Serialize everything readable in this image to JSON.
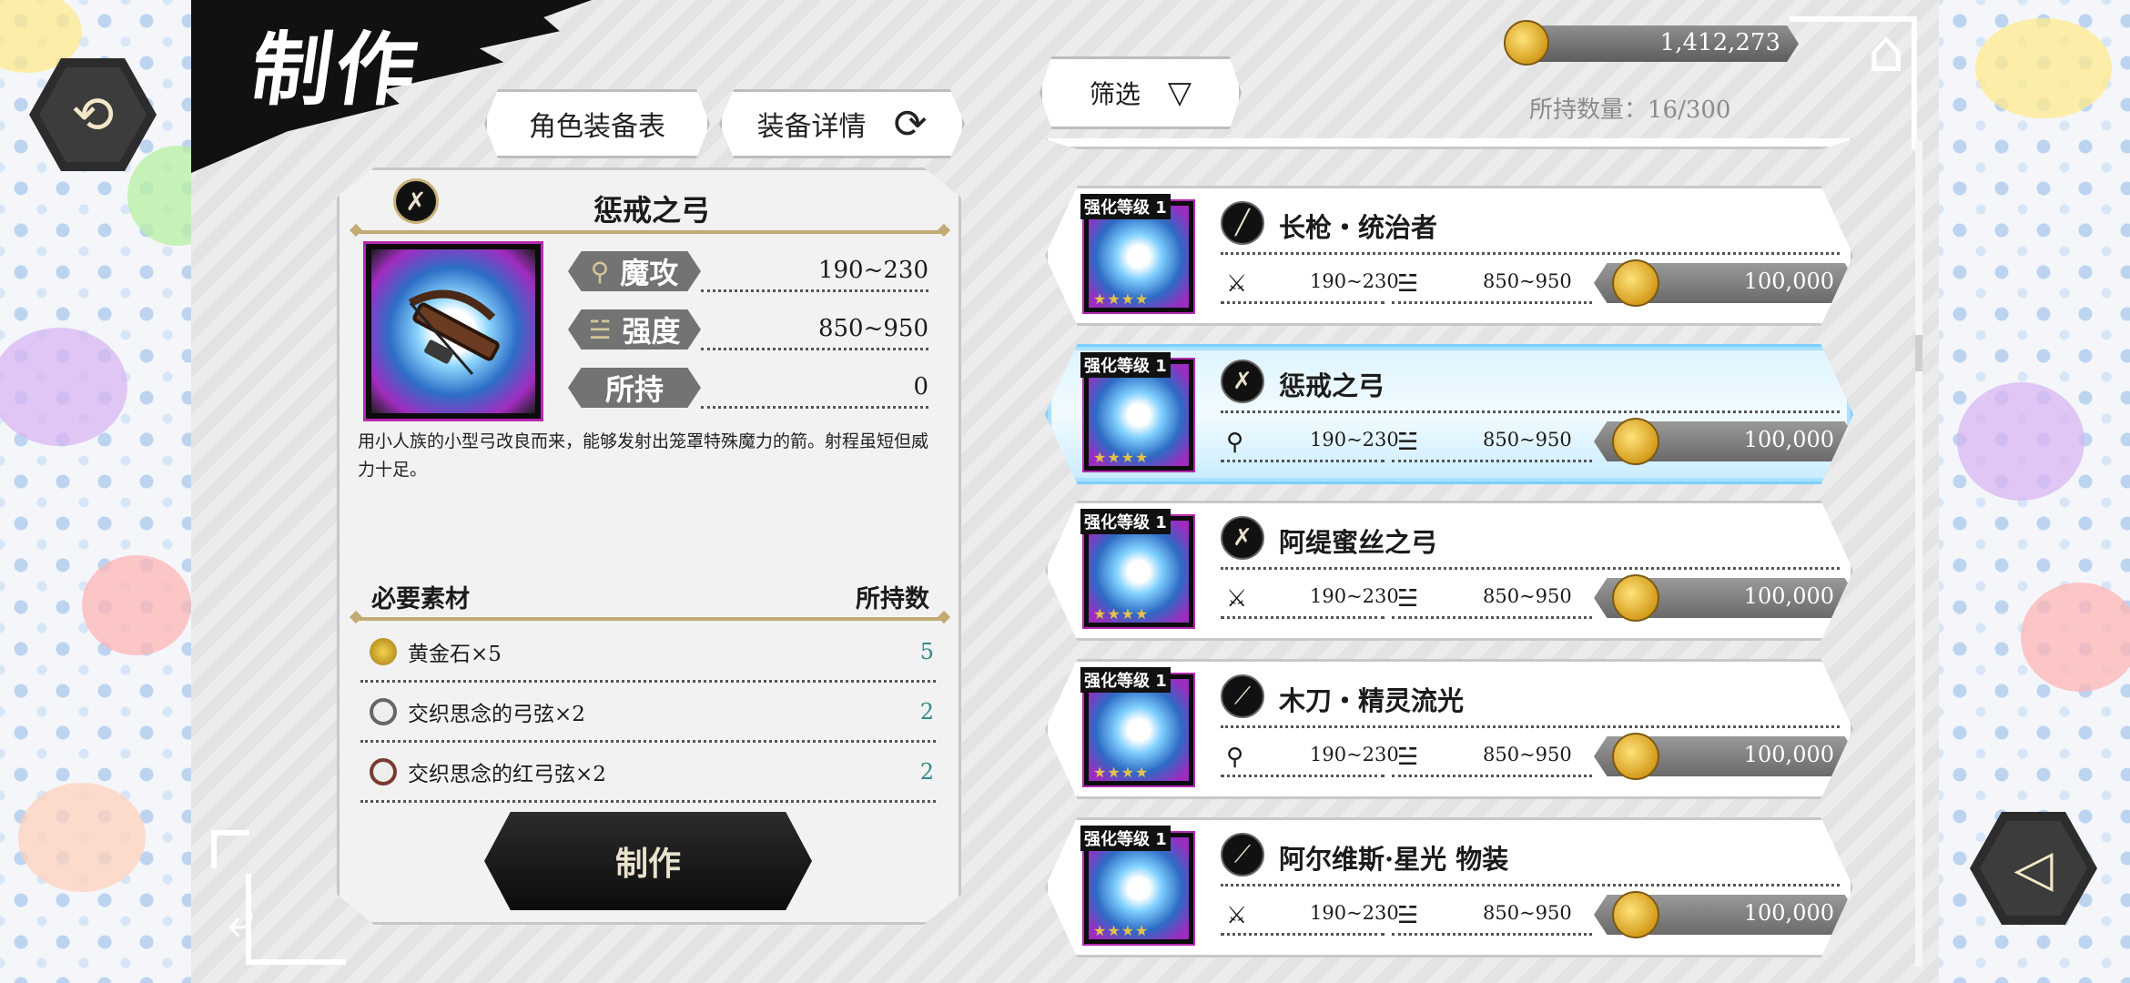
{
  "title": "制作",
  "tabs": {
    "equipment_table": "角色装备表",
    "equipment_detail": "装备详情"
  },
  "icons": {
    "swap": "swap-arrows-icon",
    "home": "home-icon",
    "mute": "sound-mute-icon",
    "back": "return-arrow-icon",
    "filter": "filter-triangle-icon",
    "coin": "gold-coin-icon"
  },
  "selected_item": {
    "name": "惩戒之弓",
    "stats": [
      {
        "label": "魔攻",
        "value": "190~230"
      },
      {
        "label": "强度",
        "value": "850~950"
      },
      {
        "label": "所持",
        "value": "0"
      }
    ],
    "description": "用小人族的小型弓改良而来，能够发射出笼罩特殊魔力的箭。射程虽短但威力十足。"
  },
  "materials": {
    "header_left": "必要素材",
    "header_right": "所持数",
    "items": [
      {
        "name": "黄金石×5",
        "count": "5"
      },
      {
        "name": "交织思念的弓弦×2",
        "count": "2"
      },
      {
        "name": "交织思念的红弓弦×2",
        "count": "2"
      }
    ]
  },
  "craft_button": "制作",
  "filter_label": "筛选",
  "currency": "1,412,273",
  "holding": "所持数量：16/300",
  "list": [
    {
      "level": "强化等级 1",
      "name": "长枪・统治者",
      "atk": "190~230",
      "def": "850~950",
      "price": "100,000",
      "selected": false
    },
    {
      "level": "强化等级 1",
      "name": "惩戒之弓",
      "atk": "190~230",
      "def": "850~950",
      "price": "100,000",
      "selected": true
    },
    {
      "level": "强化等级 1",
      "name": "阿缇蜜丝之弓",
      "atk": "190~230",
      "def": "850~950",
      "price": "100,000",
      "selected": false
    },
    {
      "level": "强化等级 1",
      "name": "木刀・精灵流光",
      "atk": "190~230",
      "def": "850~950",
      "price": "100,000",
      "selected": false
    },
    {
      "level": "强化等级 1",
      "name": "阿尔维斯·星光 物装",
      "atk": "190~230",
      "def": "850~950",
      "price": "100,000",
      "selected": false
    }
  ],
  "colors": {
    "accent_gold": "#c2ab73",
    "selected_blue": "#a8e2ff",
    "count_teal": "#2f8a8a"
  }
}
